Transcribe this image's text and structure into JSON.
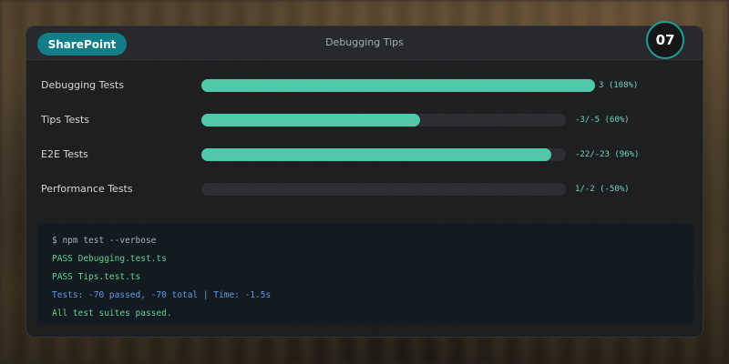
{
  "header": {
    "brand": "SharePoint",
    "title": "Debugging Tips",
    "badge": "07"
  },
  "tests": [
    {
      "label": "Debugging Tests",
      "value": "3 (108%)",
      "progress": 1.0
    },
    {
      "label": "Tips Tests",
      "value": "-3/-5 (60%)",
      "progress": 0.6
    },
    {
      "label": "E2E Tests",
      "value": "-22/-23 (96%)",
      "progress": 0.96
    },
    {
      "label": "Performance Tests",
      "value": "1/-2 (-50%)",
      "progress": 0
    }
  ],
  "terminal": {
    "lines": [
      {
        "text": "$ npm test --verbose",
        "color": "#a9b0b8"
      },
      {
        "text": "PASS Debugging.test.ts",
        "color": "#5fd18f"
      },
      {
        "text": "PASS Tips.test.ts",
        "color": "#5fd18f"
      },
      {
        "text": "Tests: -70 passed, -70 total | Time: -1.5s",
        "color": "#5b9be0"
      },
      {
        "text": "All test suites passed.",
        "color": "#5fd18f"
      }
    ]
  },
  "colors": {
    "accent": "#4fc9aa",
    "brand": "#137e88",
    "badge_ring": "#1f9c9c"
  }
}
